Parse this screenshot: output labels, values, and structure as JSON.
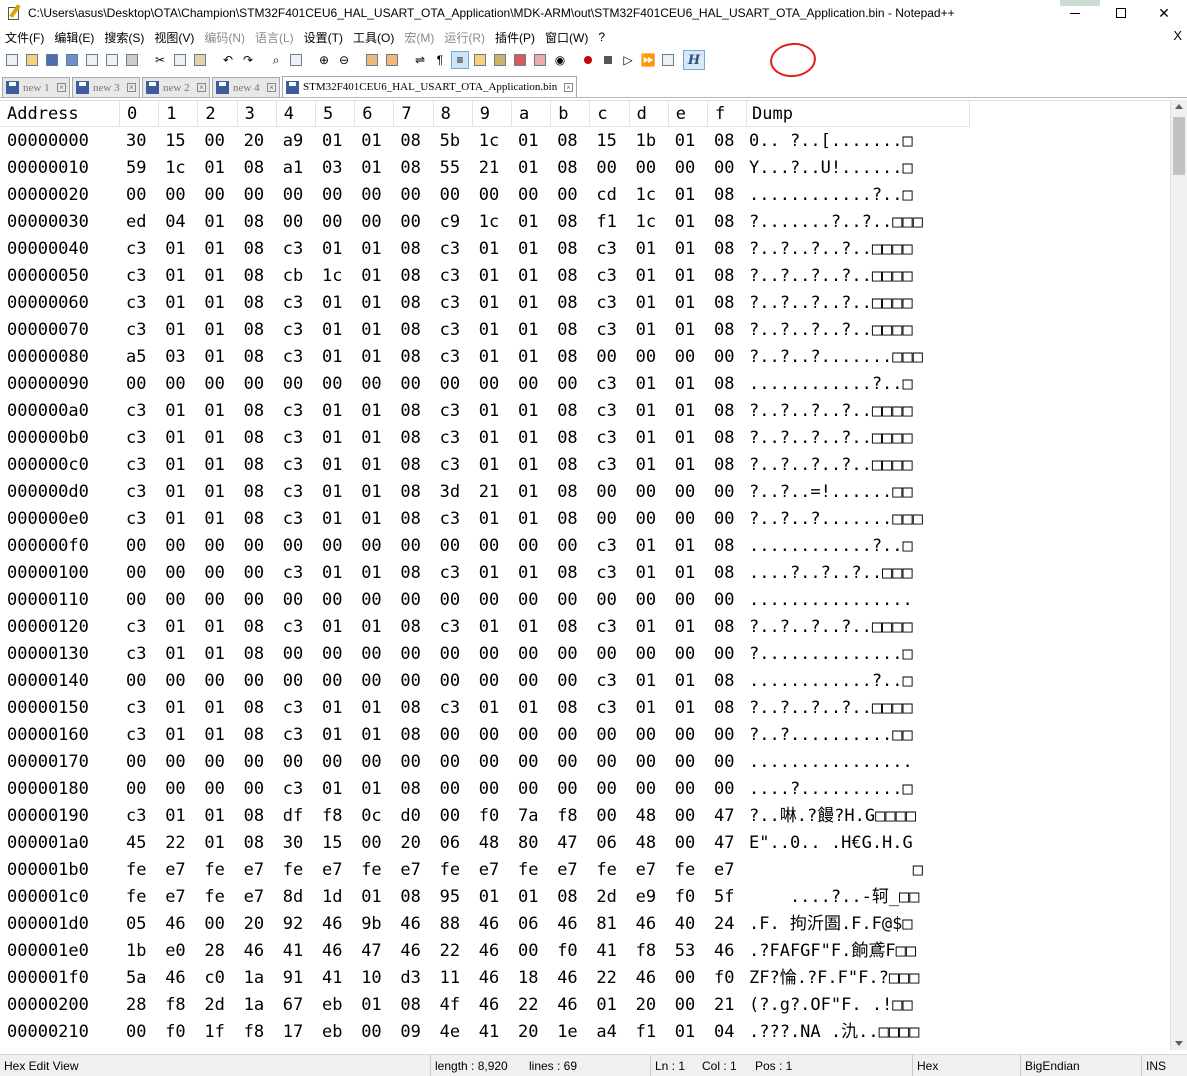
{
  "window": {
    "title": "C:\\Users\\asus\\Desktop\\OTA\\Champion\\STM32F401CEU6_HAL_USART_OTA_Application\\MDK-ARM\\out\\STM32F401CEU6_HAL_USART_OTA_Application.bin - Notepad++",
    "close_glyph": "✕"
  },
  "menu": {
    "items": [
      {
        "label": "文件(F)",
        "enabled": true
      },
      {
        "label": "编辑(E)",
        "enabled": true
      },
      {
        "label": "搜索(S)",
        "enabled": true
      },
      {
        "label": "视图(V)",
        "enabled": true
      },
      {
        "label": "编码(N)",
        "enabled": false
      },
      {
        "label": "语言(L)",
        "enabled": false
      },
      {
        "label": "设置(T)",
        "enabled": true
      },
      {
        "label": "工具(O)",
        "enabled": true
      },
      {
        "label": "宏(M)",
        "enabled": false
      },
      {
        "label": "运行(R)",
        "enabled": false
      },
      {
        "label": "插件(P)",
        "enabled": true
      },
      {
        "label": "窗口(W)",
        "enabled": true
      },
      {
        "label": "?",
        "enabled": true
      }
    ],
    "close_label": "X"
  },
  "toolbar": {
    "hex_toggle_label": "H",
    "highlight_color": "#e31d1d"
  },
  "tabs": [
    {
      "label": "new 1",
      "active": false
    },
    {
      "label": "new 3",
      "active": false
    },
    {
      "label": "new 2",
      "active": false
    },
    {
      "label": "new 4",
      "active": false
    },
    {
      "label": "STM32F401CEU6_HAL_USART_OTA_Application.bin",
      "active": true
    }
  ],
  "hex": {
    "headers": [
      "Address",
      "0",
      "1",
      "2",
      "3",
      "4",
      "5",
      "6",
      "7",
      "8",
      "9",
      "a",
      "b",
      "c",
      "d",
      "e",
      "f",
      "Dump"
    ],
    "rows": [
      {
        "addr": "00000000",
        "bytes": [
          "30",
          "15",
          "00",
          "20",
          "a9",
          "01",
          "01",
          "08",
          "5b",
          "1c",
          "01",
          "08",
          "15",
          "1b",
          "01",
          "08"
        ],
        "dump": "0.. ?..[.......□"
      },
      {
        "addr": "00000010",
        "bytes": [
          "59",
          "1c",
          "01",
          "08",
          "a1",
          "03",
          "01",
          "08",
          "55",
          "21",
          "01",
          "08",
          "00",
          "00",
          "00",
          "00"
        ],
        "dump": "Y...?..U!......□"
      },
      {
        "addr": "00000020",
        "bytes": [
          "00",
          "00",
          "00",
          "00",
          "00",
          "00",
          "00",
          "00",
          "00",
          "00",
          "00",
          "00",
          "cd",
          "1c",
          "01",
          "08"
        ],
        "dump": "............?..□"
      },
      {
        "addr": "00000030",
        "bytes": [
          "ed",
          "04",
          "01",
          "08",
          "00",
          "00",
          "00",
          "00",
          "c9",
          "1c",
          "01",
          "08",
          "f1",
          "1c",
          "01",
          "08"
        ],
        "dump": "?.......?..?..□□□"
      },
      {
        "addr": "00000040",
        "bytes": [
          "c3",
          "01",
          "01",
          "08",
          "c3",
          "01",
          "01",
          "08",
          "c3",
          "01",
          "01",
          "08",
          "c3",
          "01",
          "01",
          "08"
        ],
        "dump": "?..?..?..?..□□□□"
      },
      {
        "addr": "00000050",
        "bytes": [
          "c3",
          "01",
          "01",
          "08",
          "cb",
          "1c",
          "01",
          "08",
          "c3",
          "01",
          "01",
          "08",
          "c3",
          "01",
          "01",
          "08"
        ],
        "dump": "?..?..?..?..□□□□"
      },
      {
        "addr": "00000060",
        "bytes": [
          "c3",
          "01",
          "01",
          "08",
          "c3",
          "01",
          "01",
          "08",
          "c3",
          "01",
          "01",
          "08",
          "c3",
          "01",
          "01",
          "08"
        ],
        "dump": "?..?..?..?..□□□□"
      },
      {
        "addr": "00000070",
        "bytes": [
          "c3",
          "01",
          "01",
          "08",
          "c3",
          "01",
          "01",
          "08",
          "c3",
          "01",
          "01",
          "08",
          "c3",
          "01",
          "01",
          "08"
        ],
        "dump": "?..?..?..?..□□□□"
      },
      {
        "addr": "00000080",
        "bytes": [
          "a5",
          "03",
          "01",
          "08",
          "c3",
          "01",
          "01",
          "08",
          "c3",
          "01",
          "01",
          "08",
          "00",
          "00",
          "00",
          "00"
        ],
        "dump": "?..?..?.......□□□"
      },
      {
        "addr": "00000090",
        "bytes": [
          "00",
          "00",
          "00",
          "00",
          "00",
          "00",
          "00",
          "00",
          "00",
          "00",
          "00",
          "00",
          "c3",
          "01",
          "01",
          "08"
        ],
        "dump": "............?..□"
      },
      {
        "addr": "000000a0",
        "bytes": [
          "c3",
          "01",
          "01",
          "08",
          "c3",
          "01",
          "01",
          "08",
          "c3",
          "01",
          "01",
          "08",
          "c3",
          "01",
          "01",
          "08"
        ],
        "dump": "?..?..?..?..□□□□"
      },
      {
        "addr": "000000b0",
        "bytes": [
          "c3",
          "01",
          "01",
          "08",
          "c3",
          "01",
          "01",
          "08",
          "c3",
          "01",
          "01",
          "08",
          "c3",
          "01",
          "01",
          "08"
        ],
        "dump": "?..?..?..?..□□□□"
      },
      {
        "addr": "000000c0",
        "bytes": [
          "c3",
          "01",
          "01",
          "08",
          "c3",
          "01",
          "01",
          "08",
          "c3",
          "01",
          "01",
          "08",
          "c3",
          "01",
          "01",
          "08"
        ],
        "dump": "?..?..?..?..□□□□"
      },
      {
        "addr": "000000d0",
        "bytes": [
          "c3",
          "01",
          "01",
          "08",
          "c3",
          "01",
          "01",
          "08",
          "3d",
          "21",
          "01",
          "08",
          "00",
          "00",
          "00",
          "00"
        ],
        "dump": "?..?..=!......□□"
      },
      {
        "addr": "000000e0",
        "bytes": [
          "c3",
          "01",
          "01",
          "08",
          "c3",
          "01",
          "01",
          "08",
          "c3",
          "01",
          "01",
          "08",
          "00",
          "00",
          "00",
          "00"
        ],
        "dump": "?..?..?.......□□□"
      },
      {
        "addr": "000000f0",
        "bytes": [
          "00",
          "00",
          "00",
          "00",
          "00",
          "00",
          "00",
          "00",
          "00",
          "00",
          "00",
          "00",
          "c3",
          "01",
          "01",
          "08"
        ],
        "dump": "............?..□"
      },
      {
        "addr": "00000100",
        "bytes": [
          "00",
          "00",
          "00",
          "00",
          "c3",
          "01",
          "01",
          "08",
          "c3",
          "01",
          "01",
          "08",
          "c3",
          "01",
          "01",
          "08"
        ],
        "dump": "....?..?..?..□□□"
      },
      {
        "addr": "00000110",
        "bytes": [
          "00",
          "00",
          "00",
          "00",
          "00",
          "00",
          "00",
          "00",
          "00",
          "00",
          "00",
          "00",
          "00",
          "00",
          "00",
          "00"
        ],
        "dump": "................"
      },
      {
        "addr": "00000120",
        "bytes": [
          "c3",
          "01",
          "01",
          "08",
          "c3",
          "01",
          "01",
          "08",
          "c3",
          "01",
          "01",
          "08",
          "c3",
          "01",
          "01",
          "08"
        ],
        "dump": "?..?..?..?..□□□□"
      },
      {
        "addr": "00000130",
        "bytes": [
          "c3",
          "01",
          "01",
          "08",
          "00",
          "00",
          "00",
          "00",
          "00",
          "00",
          "00",
          "00",
          "00",
          "00",
          "00",
          "00"
        ],
        "dump": "?..............□"
      },
      {
        "addr": "00000140",
        "bytes": [
          "00",
          "00",
          "00",
          "00",
          "00",
          "00",
          "00",
          "00",
          "00",
          "00",
          "00",
          "00",
          "c3",
          "01",
          "01",
          "08"
        ],
        "dump": "............?..□"
      },
      {
        "addr": "00000150",
        "bytes": [
          "c3",
          "01",
          "01",
          "08",
          "c3",
          "01",
          "01",
          "08",
          "c3",
          "01",
          "01",
          "08",
          "c3",
          "01",
          "01",
          "08"
        ],
        "dump": "?..?..?..?..□□□□"
      },
      {
        "addr": "00000160",
        "bytes": [
          "c3",
          "01",
          "01",
          "08",
          "c3",
          "01",
          "01",
          "08",
          "00",
          "00",
          "00",
          "00",
          "00",
          "00",
          "00",
          "00"
        ],
        "dump": "?..?..........□□"
      },
      {
        "addr": "00000170",
        "bytes": [
          "00",
          "00",
          "00",
          "00",
          "00",
          "00",
          "00",
          "00",
          "00",
          "00",
          "00",
          "00",
          "00",
          "00",
          "00",
          "00"
        ],
        "dump": "................"
      },
      {
        "addr": "00000180",
        "bytes": [
          "00",
          "00",
          "00",
          "00",
          "c3",
          "01",
          "01",
          "08",
          "00",
          "00",
          "00",
          "00",
          "00",
          "00",
          "00",
          "00"
        ],
        "dump": "....?..........□"
      },
      {
        "addr": "00000190",
        "bytes": [
          "c3",
          "01",
          "01",
          "08",
          "df",
          "f8",
          "0c",
          "d0",
          "00",
          "f0",
          "7a",
          "f8",
          "00",
          "48",
          "00",
          "47"
        ],
        "dump": "?..啉.?饅?H.G□□□□"
      },
      {
        "addr": "000001a0",
        "bytes": [
          "45",
          "22",
          "01",
          "08",
          "30",
          "15",
          "00",
          "20",
          "06",
          "48",
          "80",
          "47",
          "06",
          "48",
          "00",
          "47"
        ],
        "dump": "E\"..0.. .H€G.H.G"
      },
      {
        "addr": "000001b0",
        "bytes": [
          "fe",
          "e7",
          "fe",
          "e7",
          "fe",
          "e7",
          "fe",
          "e7",
          "fe",
          "e7",
          "fe",
          "e7",
          "fe",
          "e7",
          "fe",
          "e7"
        ],
        "dump": "                □"
      },
      {
        "addr": "000001c0",
        "bytes": [
          "fe",
          "e7",
          "fe",
          "e7",
          "8d",
          "1d",
          "01",
          "08",
          "95",
          "01",
          "01",
          "08",
          "2d",
          "e9",
          "f0",
          "5f"
        ],
        "dump": "    ....?..-轲_□□"
      },
      {
        "addr": "000001d0",
        "bytes": [
          "05",
          "46",
          "00",
          "20",
          "92",
          "46",
          "9b",
          "46",
          "88",
          "46",
          "06",
          "46",
          "81",
          "46",
          "40",
          "24"
        ],
        "dump": ".F. 拘沂圄.F.F@$□"
      },
      {
        "addr": "000001e0",
        "bytes": [
          "1b",
          "e0",
          "28",
          "46",
          "41",
          "46",
          "47",
          "46",
          "22",
          "46",
          "00",
          "f0",
          "41",
          "f8",
          "53",
          "46"
        ],
        "dump": ".?FAFGF\"F.餉鳶F□□"
      },
      {
        "addr": "000001f0",
        "bytes": [
          "5a",
          "46",
          "c0",
          "1a",
          "91",
          "41",
          "10",
          "d3",
          "11",
          "46",
          "18",
          "46",
          "22",
          "46",
          "00",
          "f0"
        ],
        "dump": "ZF?惀.?F.F\"F.?□□□"
      },
      {
        "addr": "00000200",
        "bytes": [
          "28",
          "f8",
          "2d",
          "1a",
          "67",
          "eb",
          "01",
          "08",
          "4f",
          "46",
          "22",
          "46",
          "01",
          "20",
          "00",
          "21"
        ],
        "dump": "(?.g?.OF\"F. .!□□"
      },
      {
        "addr": "00000210",
        "bytes": [
          "00",
          "f0",
          "1f",
          "f8",
          "17",
          "eb",
          "00",
          "09",
          "4e",
          "41",
          "20",
          "1e",
          "a4",
          "f1",
          "01",
          "04"
        ],
        "dump": ".???.NA .氿..□□□□"
      }
    ]
  },
  "statusbar": {
    "mode": "Hex Edit View",
    "length": "length : 8,920",
    "lines": "lines : 69",
    "ln": "Ln : 1",
    "col": "Col : 1",
    "pos": "Pos : 1",
    "view": "Hex",
    "endian": "BigEndian",
    "ins": "INS"
  }
}
